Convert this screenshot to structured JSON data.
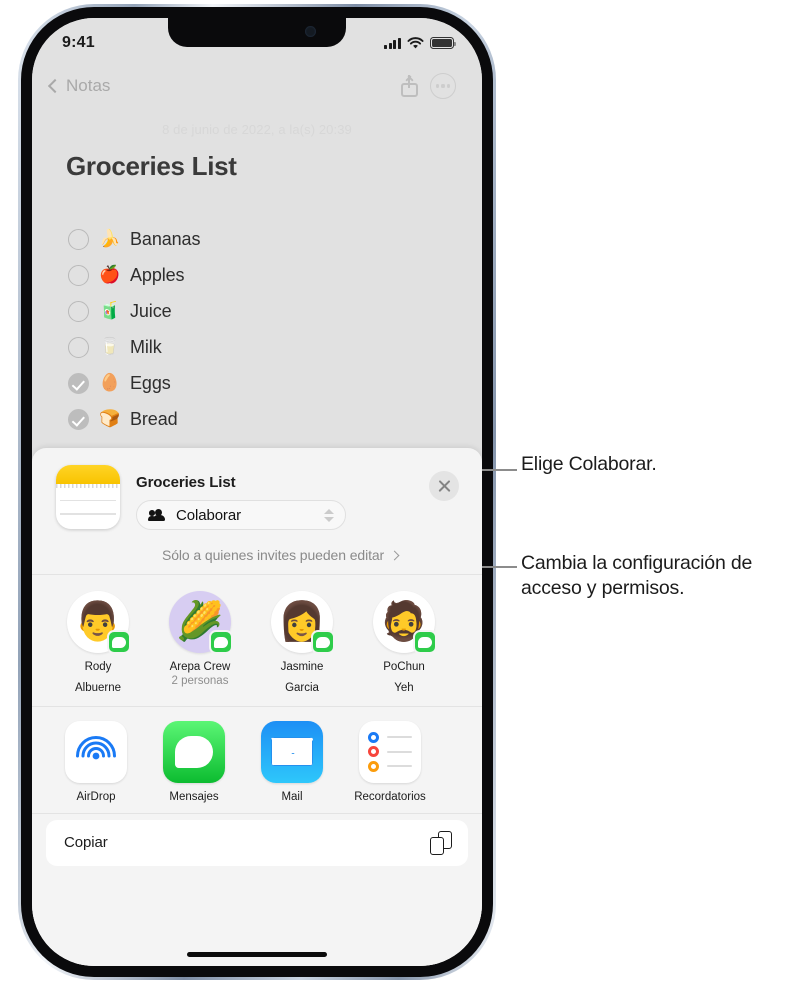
{
  "status_bar": {
    "time": "9:41",
    "signal_icon": "cellular-bars-icon",
    "wifi_icon": "wifi-icon",
    "battery_icon": "battery-icon"
  },
  "nav_bar": {
    "back_label": "Notas",
    "share_icon": "share-icon",
    "more_icon": "more-ellipsis-icon"
  },
  "note": {
    "date": "8 de junio de 2022, a la(s) 20:39",
    "title": "Groceries List",
    "items": [
      {
        "emoji": "🍌",
        "label": "Bananas",
        "checked": false
      },
      {
        "emoji": "🍎",
        "label": "Apples",
        "checked": false
      },
      {
        "emoji": "🧃",
        "label": "Juice",
        "checked": false
      },
      {
        "emoji": "🥛",
        "label": "Milk",
        "checked": false
      },
      {
        "emoji": "🥚",
        "label": "Eggs",
        "checked": true
      },
      {
        "emoji": "🍞",
        "label": "Bread",
        "checked": true
      }
    ]
  },
  "share_sheet": {
    "app_icon": "notes-app-icon",
    "title": "Groceries List",
    "close_icon": "close-icon",
    "collaborate": {
      "icon": "people-icon",
      "label": "Colaborar",
      "chevron_icon": "up-down-chevron-icon"
    },
    "permissions": {
      "label": "Sólo a quienes invites pueden editar",
      "chevron_icon": "chevron-right-icon"
    },
    "contacts": [
      {
        "avatar": "👨",
        "name": "Rody\nAlbuerne",
        "name_line1": "Rody",
        "name_line2": "Albuerne",
        "sub": "",
        "badge": "messages-badge-icon"
      },
      {
        "avatar": "🌽",
        "name": "Arepa Crew",
        "name_line1": "Arepa Crew",
        "name_line2": "",
        "sub": "2 personas",
        "badge": "messages-badge-icon"
      },
      {
        "avatar": "👩",
        "name": "Jasmine\nGarcia",
        "name_line1": "Jasmine",
        "name_line2": "Garcia",
        "sub": "",
        "badge": "messages-badge-icon"
      },
      {
        "avatar": "🧔",
        "name": "PoChun\nYeh",
        "name_line1": "PoChun",
        "name_line2": "Yeh",
        "sub": "",
        "badge": "messages-badge-icon"
      }
    ],
    "apps": [
      {
        "icon": "airdrop-icon",
        "label": "AirDrop"
      },
      {
        "icon": "messages-icon",
        "label": "Mensajes"
      },
      {
        "icon": "mail-icon",
        "label": "Mail"
      },
      {
        "icon": "reminders-icon",
        "label": "Recordatorios"
      }
    ],
    "copy_action": {
      "label": "Copiar",
      "icon": "copy-icon"
    }
  },
  "callouts": [
    {
      "text": "Elige Colaborar."
    },
    {
      "text": "Cambia la configuración de acceso y permisos."
    }
  ],
  "colors": {
    "note_bg": "#e1e1e1",
    "sheet_bg": "#f4f4f4",
    "messages_green": "#2ecc4a",
    "notes_yellow": "#f8c300",
    "mail_blue": "#1d8ff5",
    "reminder_blue": "#1a7af5",
    "reminder_red": "#f7453c",
    "reminder_orange": "#fb9c0c"
  }
}
